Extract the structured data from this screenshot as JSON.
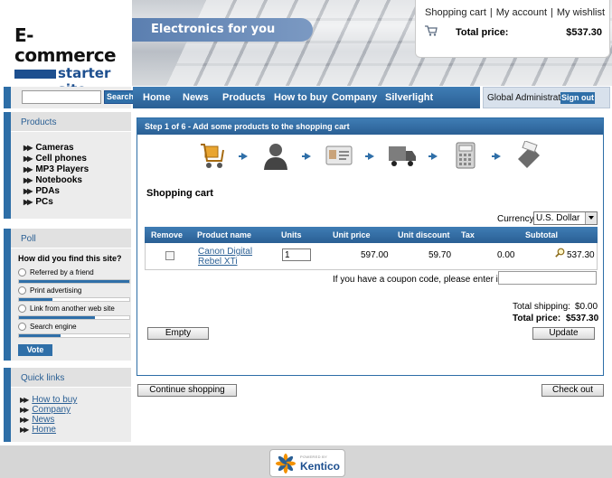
{
  "logo": {
    "line1": "E-commerce",
    "line2": "starter site"
  },
  "banner": {
    "title": "Electronics for you"
  },
  "cart_box": {
    "links": [
      "Shopping cart",
      "My account",
      "My wishlist"
    ],
    "total_label": "Total price:",
    "total_value": "$537.30"
  },
  "search": {
    "value": "",
    "button": "Search"
  },
  "nav": {
    "items": [
      "Home",
      "News",
      "Products",
      "How to buy",
      "Company",
      "Silverlight"
    ]
  },
  "user": {
    "name": "Global Administrator",
    "signout": "Sign out"
  },
  "products": {
    "header": "Products",
    "items": [
      "Cameras",
      "Cell phones",
      "MP3 Players",
      "Notebooks",
      "PDAs",
      "PCs"
    ]
  },
  "poll": {
    "header": "Poll",
    "question": "How did you find this site?",
    "options": [
      {
        "label": "Referred by a friend",
        "level": 1.0
      },
      {
        "label": "Print advertising",
        "level": 0.3
      },
      {
        "label": "Link from another web site",
        "level": 0.69
      },
      {
        "label": "Search engine",
        "level": 0.38
      }
    ],
    "vote": "Vote"
  },
  "quick_links": {
    "header": "Quick links",
    "items": [
      "How to buy",
      "Company",
      "News",
      "Home"
    ]
  },
  "step": {
    "title": "Step 1 of 6 - Add some products to the shopping cart"
  },
  "cart": {
    "title": "Shopping cart",
    "currency_label": "Currency:",
    "currency_value": "U.S. Dollar",
    "columns": [
      "Remove",
      "Product name",
      "Units",
      "Unit price",
      "Unit discount",
      "Tax",
      "Subtotal"
    ],
    "row": {
      "product": "Canon Digital Rebel XTi",
      "units": "1",
      "unit_price": "597.00",
      "unit_discount": "59.70",
      "tax": "0.00",
      "subtotal": "537.30"
    },
    "coupon_label": "If you have a coupon code, please enter it here:",
    "total_shipping_label": "Total shipping:",
    "total_shipping_value": "$0.00",
    "total_price_label": "Total price:",
    "total_price_value": "$537.30",
    "empty_button": "Empty",
    "update_button": "Update"
  },
  "buttons": {
    "continue": "Continue shopping",
    "checkout": "Check out"
  },
  "footer": {
    "powered": "POWERED BY",
    "brand": "Kentico"
  }
}
